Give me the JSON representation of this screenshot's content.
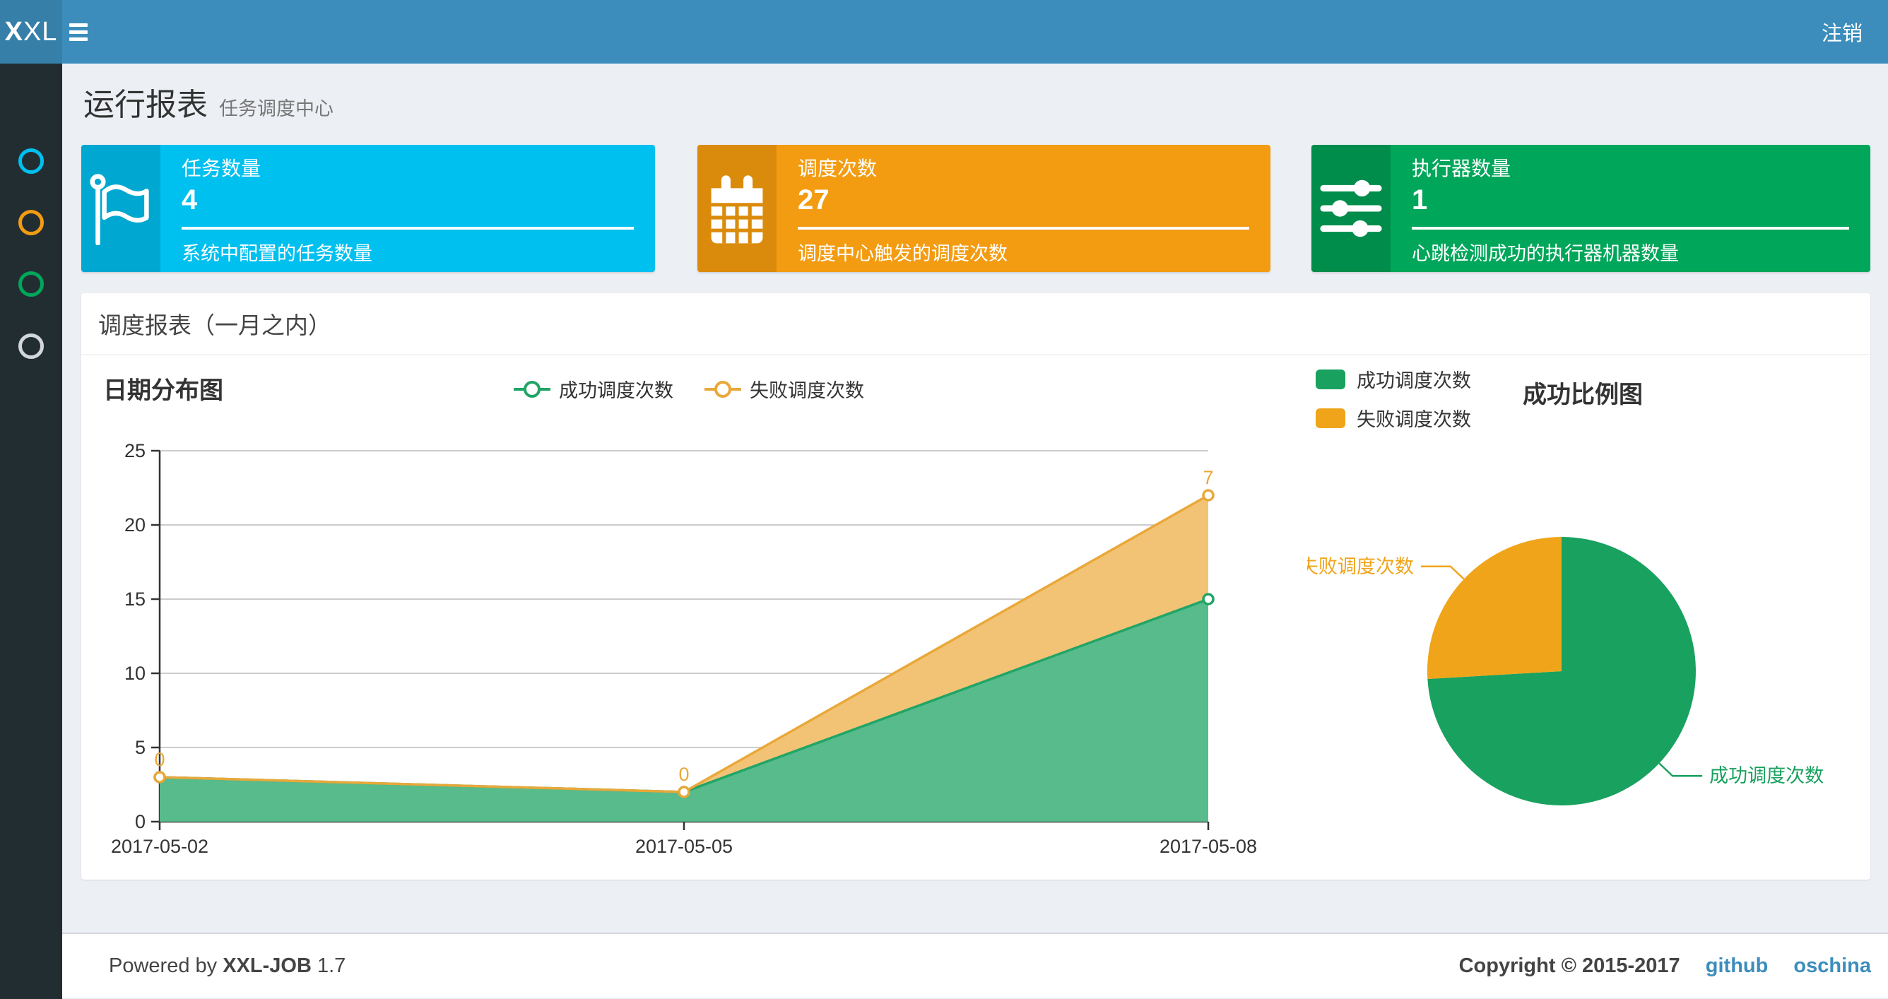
{
  "navbar": {
    "logo_bold": "X",
    "logo_rest": "XL",
    "logout_label": "注销"
  },
  "sidebar": {
    "items": [
      {
        "color": "#00c0ef"
      },
      {
        "color": "#f39c12"
      },
      {
        "color": "#00a65a"
      },
      {
        "color": "#d2d6de"
      }
    ]
  },
  "page_header": {
    "title": "运行报表",
    "subtitle": "任务调度中心"
  },
  "cards": [
    {
      "title": "任务数量",
      "value": "4",
      "desc": "系统中配置的任务数量",
      "bg": "#00c0ef",
      "icon_bg": "#00a7d0",
      "icon": "flag-icon"
    },
    {
      "title": "调度次数",
      "value": "27",
      "desc": "调度中心触发的调度次数",
      "bg": "#f39c12",
      "icon_bg": "#db8b0b",
      "icon": "calendar-icon"
    },
    {
      "title": "执行器数量",
      "value": "1",
      "desc": "心跳检测成功的执行器机器数量",
      "bg": "#00a65a",
      "icon_bg": "#008d4c",
      "icon": "sliders-icon"
    }
  ],
  "panel": {
    "title": "调度报表（一月之内）"
  },
  "chart_data": [
    {
      "type": "area",
      "title": "日期分布图",
      "categories": [
        "2017-05-02",
        "2017-05-05",
        "2017-05-08"
      ],
      "series": [
        {
          "name": "成功调度次数",
          "values": [
            3,
            2,
            15
          ],
          "color": "#21a567",
          "area": "#57bb8b"
        },
        {
          "name": "失败调度次数",
          "values": [
            0,
            0,
            7
          ],
          "color": "#e9a83a",
          "area": "#f3c375",
          "stacked_on": "成功调度次数",
          "point_labels": [
            0,
            0,
            7
          ]
        }
      ],
      "ylim": [
        0,
        25
      ],
      "yticks": [
        0,
        5,
        10,
        15,
        20,
        25
      ],
      "grid": true,
      "legend_position": "top"
    },
    {
      "type": "pie",
      "title": "成功比例图",
      "slices": [
        {
          "name": "成功调度次数",
          "value": 20,
          "color": "#19a15f"
        },
        {
          "name": "失败调度次数",
          "value": 7,
          "color": "#f0a41a"
        }
      ],
      "legend_position": "top-left"
    }
  ],
  "footer": {
    "powered_prefix": "Powered by",
    "brand": "XXL-JOB",
    "version": "1.7",
    "copyright": "Copyright © 2015-2017",
    "links": [
      "github",
      "oschina"
    ]
  }
}
